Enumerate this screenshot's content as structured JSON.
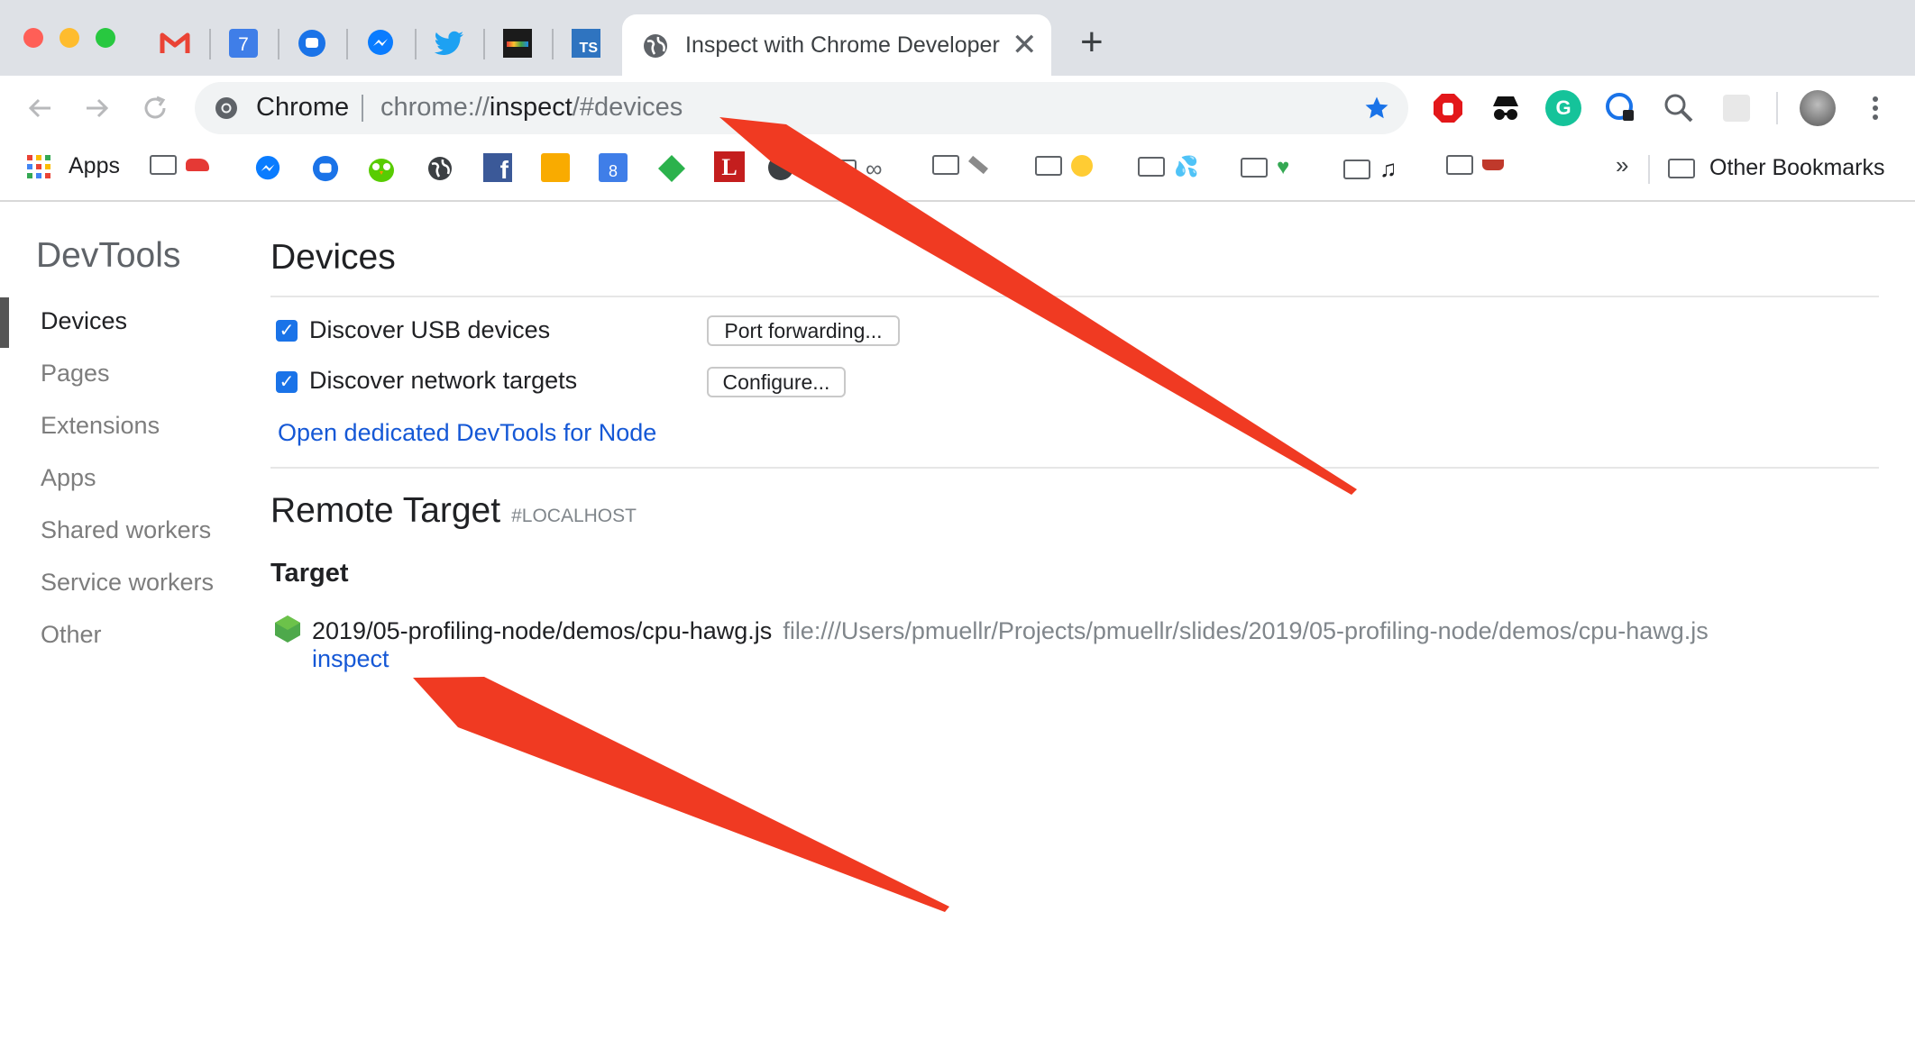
{
  "tabs": {
    "active_title": "Inspect with Chrome Developer Tools",
    "calendar_day": "7",
    "new_tab_glyph": "+",
    "close_glyph": "✕"
  },
  "omnibox": {
    "site_label": "Chrome",
    "url_prefix": "chrome://",
    "url_bold": "inspect",
    "url_suffix": "/#devices"
  },
  "bookmarks": {
    "apps_label": "Apps",
    "calendar_day": "8",
    "overflow": "»",
    "other": "Other Bookmarks"
  },
  "sidebar": {
    "title": "DevTools",
    "items": [
      "Devices",
      "Pages",
      "Extensions",
      "Apps",
      "Shared workers",
      "Service workers",
      "Other"
    ],
    "selected": "Devices"
  },
  "devices": {
    "title": "Devices",
    "usb_label": "Discover USB devices",
    "usb_checked": true,
    "port_forwarding_button": "Port forwarding...",
    "network_label": "Discover network targets",
    "network_checked": true,
    "configure_button": "Configure...",
    "node_link": "Open dedicated DevTools for Node"
  },
  "remote": {
    "title": "Remote Target",
    "host": "#LOCALHOST",
    "target_header": "Target",
    "target_name": "2019/05-profiling-node/demos/cpu-hawg.js",
    "target_url": "file:///Users/pmuellr/Projects/pmuellr/slides/2019/05-profiling-node/demos/cpu-hawg.js",
    "inspect_link": "inspect"
  },
  "colors": {
    "tabstrip": "#dee1e6",
    "link": "#1558d6",
    "checkbox": "#1a73e8",
    "annotation_arrow": "#f03a22"
  }
}
